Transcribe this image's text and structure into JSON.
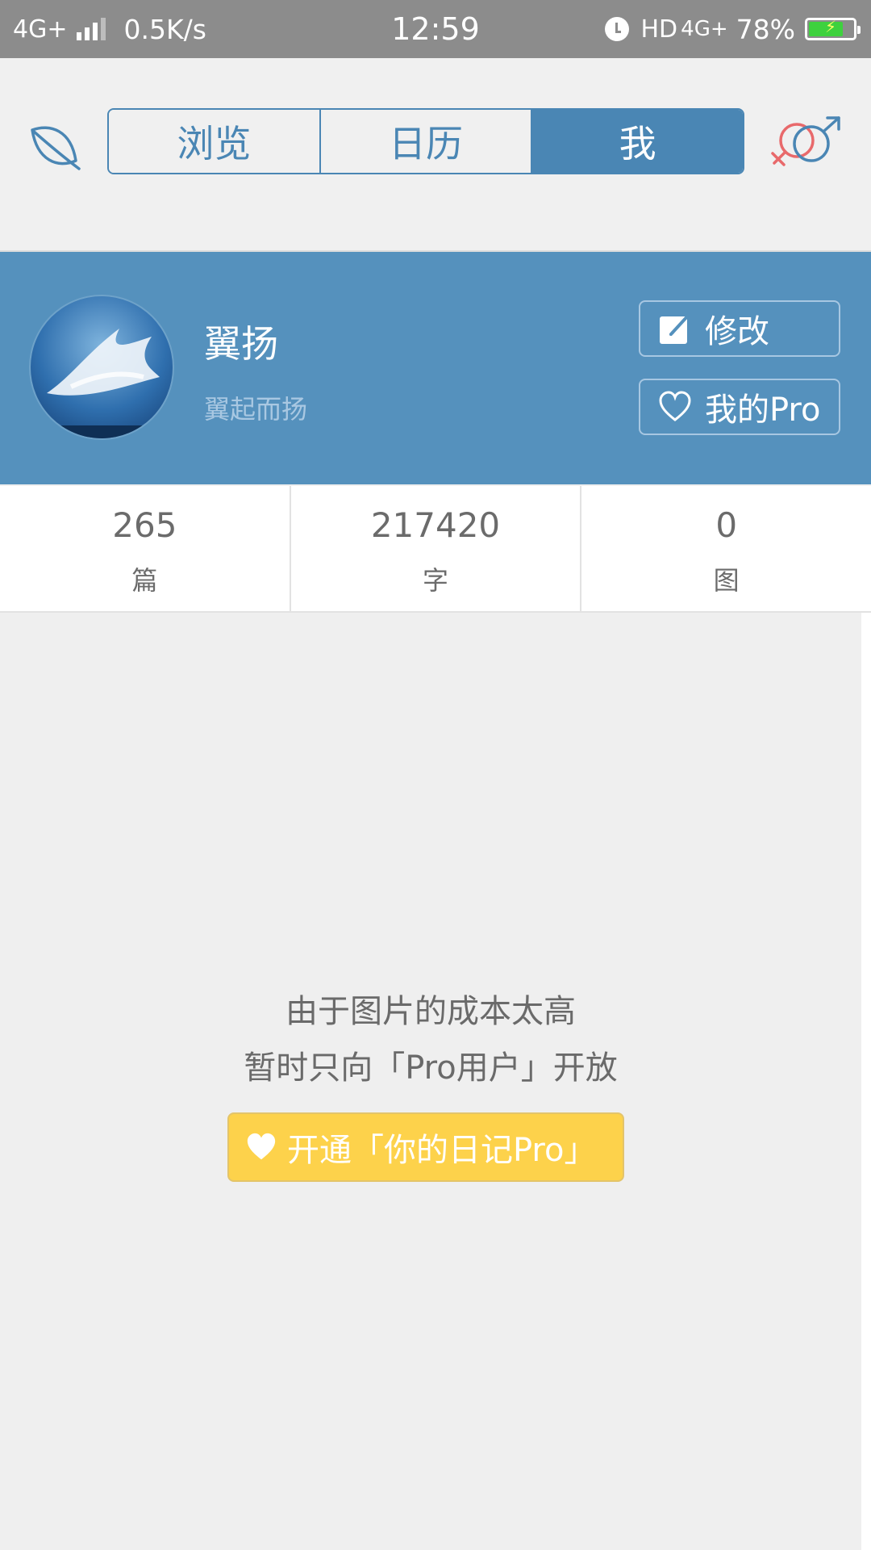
{
  "status_bar": {
    "network_left": "4G+",
    "speed": "0.5K/s",
    "time": "12:59",
    "hd": "HD",
    "network_right": "4G+",
    "battery_percent": "78%",
    "battery_level": 0.78
  },
  "nav": {
    "leaf_icon": "leaf-icon",
    "tabs": [
      {
        "label": "浏览",
        "active": false
      },
      {
        "label": "日历",
        "active": false
      },
      {
        "label": "我",
        "active": true
      }
    ],
    "gender_icon": "gender-icon"
  },
  "profile": {
    "name": "翼扬",
    "motto": "翼起而扬",
    "edit_label": "修改",
    "pro_label": "我的Pro"
  },
  "stats": [
    {
      "value": "265",
      "unit": "篇"
    },
    {
      "value": "217420",
      "unit": "字"
    },
    {
      "value": "0",
      "unit": "图"
    }
  ],
  "notice": {
    "line1": "由于图片的成本太高",
    "line2": "暂时只向「Pro用户」开放",
    "cta_label": "开通「你的日记Pro」"
  },
  "colors": {
    "accent": "#4a86b4",
    "profile_bg": "#5591bd",
    "cta_bg": "#fdd24b",
    "gender_female": "#e8696b",
    "gender_male": "#4a86b4"
  }
}
